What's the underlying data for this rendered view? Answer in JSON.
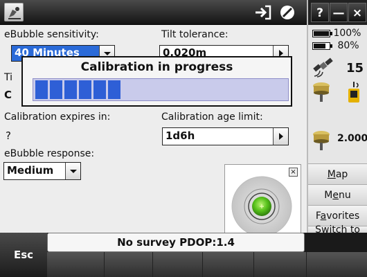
{
  "titlebar": {
    "app_icon": "survey-app-icon",
    "login_icon": "login-arrow-icon",
    "stop_icon": "stop-icon"
  },
  "window_buttons": {
    "help": "?",
    "minimize": "—",
    "close": "×"
  },
  "form": {
    "ebubble_sensitivity": {
      "label": "eBubble sensitivity:",
      "value": "40 Minutes"
    },
    "tilt_tolerance": {
      "label": "Tilt tolerance:",
      "value": "0.020m"
    },
    "hidden_label_initial": "Ti",
    "hidden_value_initial": "C",
    "calibration_expires": {
      "label": "Calibration expires in:",
      "value": "?"
    },
    "calibration_age_limit": {
      "label": "Calibration age limit:",
      "value": "1d6h"
    },
    "ebubble_response": {
      "label": "eBubble response:",
      "value": "Medium"
    }
  },
  "calibration_dialog": {
    "title": "Calibration in progress",
    "progress_segments_filled": 6
  },
  "right_panel": {
    "battery1_percent": "100%",
    "battery2_percent": "80%",
    "satellite_count": "15",
    "antenna_height": "2.000",
    "buttons": [
      {
        "label": "Map",
        "ul": "M",
        "rest": "ap"
      },
      {
        "label": "Menu",
        "pre": "M",
        "ul": "e",
        "rest": "nu"
      },
      {
        "label": "Favorites",
        "pre": "F",
        "ul": "a",
        "rest": "vorites"
      },
      {
        "label": "Switch to",
        "pre": "S",
        "ul": "w",
        "rest": "itch to"
      }
    ]
  },
  "status": {
    "text": "No survey  PDOP:1.4"
  },
  "softkeys": {
    "esc": "Esc"
  },
  "colors": {
    "selection": "#2a6ad8",
    "progress": "#2e5fd6",
    "bubble_green": "#58c21c"
  }
}
